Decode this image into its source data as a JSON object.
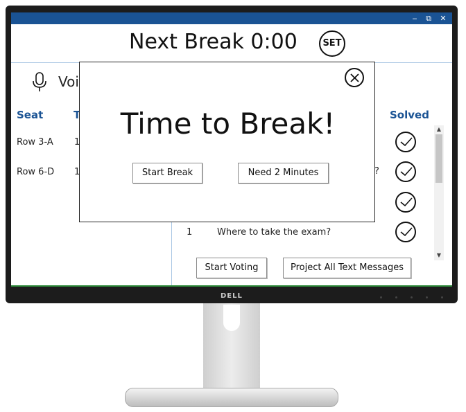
{
  "window": {
    "minimize": "‒",
    "restore": "⧉",
    "close": "✕"
  },
  "header": {
    "title": "Next Break 0:00",
    "set_label": "SET"
  },
  "voice": {
    "label_partial": "Voi",
    "icon": "microphone-icon"
  },
  "table_left": {
    "headers": {
      "seat": "Seat",
      "t_partial": "T"
    },
    "rows": [
      {
        "seat": "Row 3-A",
        "t": "1"
      },
      {
        "seat": "Row 6-D",
        "t": "1"
      }
    ]
  },
  "table_right": {
    "header_solved": "Solved",
    "visible_question": {
      "num": "1",
      "text": "Where to take the exam?"
    },
    "partial_text": "?",
    "solved_count": 4
  },
  "buttons": {
    "start_voting": "Start Voting",
    "project_all": "Project All Text Messages"
  },
  "modal": {
    "title": "Time to Break!",
    "start_break": "Start Break",
    "need_2_minutes": "Need 2 Minutes"
  },
  "monitor": {
    "brand": "DELL"
  },
  "colors": {
    "accent": "#1a5394",
    "divider": "#a9c6e4"
  }
}
